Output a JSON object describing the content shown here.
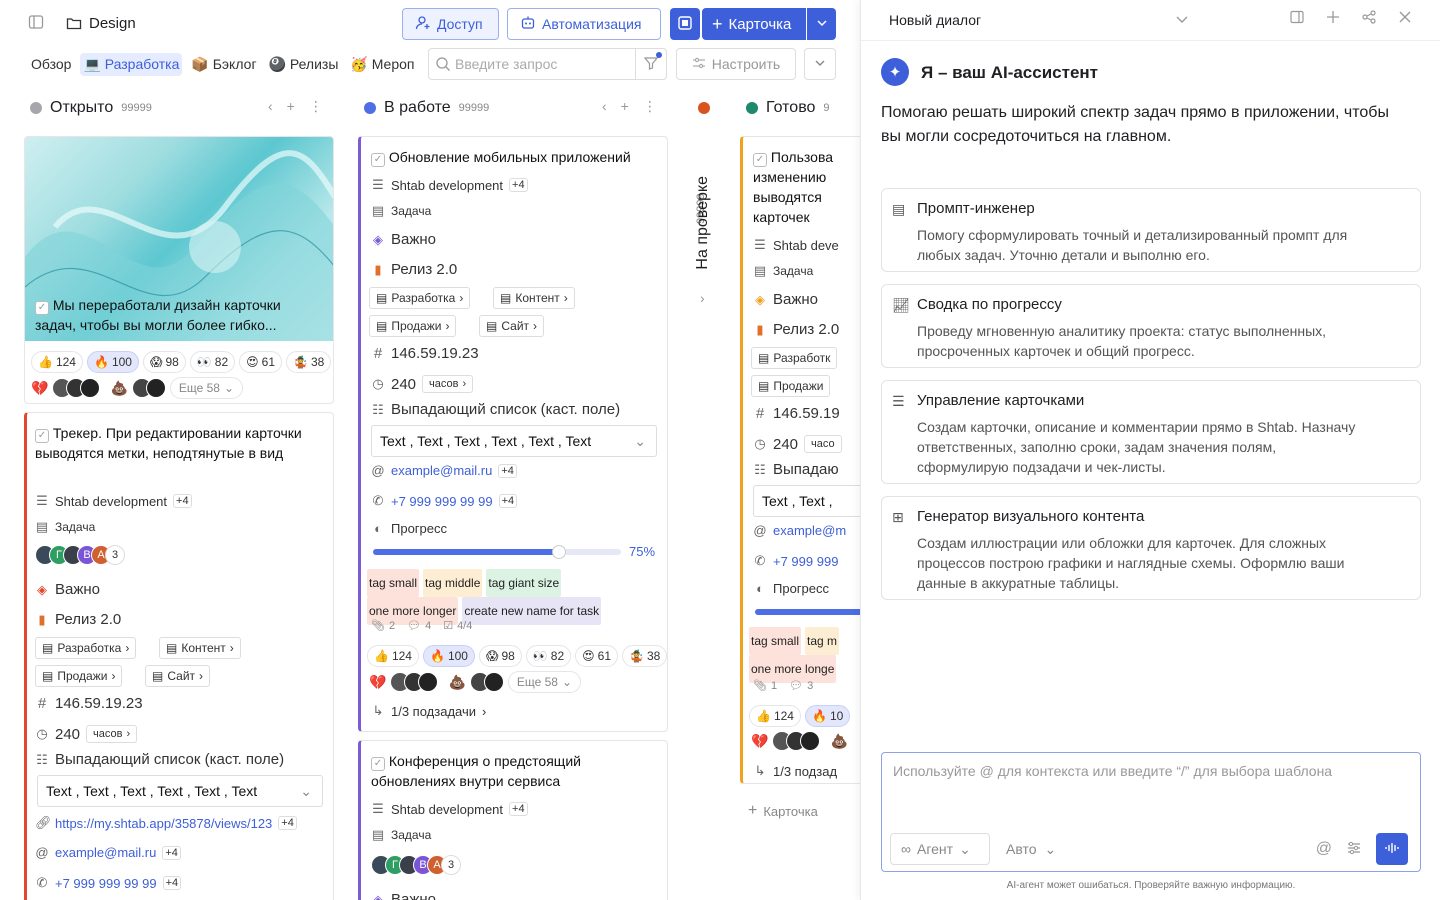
{
  "topbar": {
    "title": "Design",
    "access": "Доступ",
    "automation": "Автоматизация",
    "card_btn": "Карточка"
  },
  "tabs": [
    {
      "label": "Обзор"
    },
    {
      "label": "Разработка"
    },
    {
      "label": "Бэклог"
    },
    {
      "label": "Релизы"
    },
    {
      "label": "Мероп"
    }
  ],
  "tab_icons": [
    "",
    "💻",
    "📦",
    "🎱",
    "🥳"
  ],
  "search": {
    "placeholder": "Введите запрос"
  },
  "setup_label": "Настроить",
  "columns": [
    {
      "name": "Открыто",
      "count": "99999",
      "color": "#a6a6ad"
    },
    {
      "name": "В работе",
      "count": "99999",
      "color": "#4e6ee6"
    },
    {
      "name": "На проверке",
      "count": "99999",
      "color": "#d9531e"
    },
    {
      "name": "Готово",
      "count": "9",
      "color": "#1f8a6b"
    }
  ],
  "col1": {
    "card1": {
      "title": "Мы переработали дизайн карточки задач, чтобы вы могли более гибко...",
      "reactions": [
        {
          "e": "👍",
          "n": "124"
        },
        {
          "e": "🔥",
          "n": "100"
        },
        {
          "e": "😱",
          "n": "98"
        },
        {
          "e": "👀",
          "n": "82"
        },
        {
          "e": "😍",
          "n": "61"
        },
        {
          "e": "🤹",
          "n": "38"
        }
      ],
      "more": "Еще 58"
    },
    "card2": {
      "title": "Трекер. При редактировании карточки выводятся метки, неподтянутые в вид",
      "project": "Shtab development",
      "plus4": "+4",
      "type": "Задача",
      "avatars_count": "3",
      "priority": "Важно",
      "release": "Релиз 2.0",
      "chips": [
        "Разработка",
        "Контент",
        "Продажи",
        "Сайт"
      ],
      "ip": "146.59.19.23",
      "hours": "240",
      "hours_unit": "часов",
      "dropdown_label": "Выпадающий список (каст. поле)",
      "dropdown_value": "Text , Text , Text , Text , Text , Text",
      "url": "https://my.shtab.app/35878/views/123",
      "email": "example@mail.ru",
      "phone": "+7 999 999 99 99"
    }
  },
  "col2": {
    "card1": {
      "title": "Обновление мобильных приложений",
      "project": "Shtab development",
      "plus4": "+4",
      "type": "Задача",
      "priority": "Важно",
      "release": "Релиз 2.0",
      "chips": [
        "Разработка",
        "Контент",
        "Продажи",
        "Сайт"
      ],
      "ip": "146.59.19.23",
      "hours": "240",
      "hours_unit": "часов",
      "dropdown_label": "Выпадающий список (каст. поле)",
      "dropdown_value": "Text , Text , Text , Text , Text , Text",
      "email": "example@mail.ru",
      "phone": "+7 999 999 99 99",
      "progress_label": "Прогресс",
      "progress": 0.75,
      "progress_text": "75%",
      "tags": [
        {
          "t": "tag small",
          "c": "#fde2dc"
        },
        {
          "t": "tag middle",
          "c": "#fdeed3"
        },
        {
          "t": "tag giant size",
          "c": "#dcf2e3"
        },
        {
          "t": "one more longer",
          "c": "#fde2dc"
        },
        {
          "t": "create new name for task",
          "c": "#e6e4f5"
        }
      ],
      "attach": "2",
      "comments": "4",
      "checks": "4/4",
      "reactions": [
        {
          "e": "👍",
          "n": "124"
        },
        {
          "e": "🔥",
          "n": "100"
        },
        {
          "e": "😱",
          "n": "98"
        },
        {
          "e": "👀",
          "n": "82"
        },
        {
          "e": "😍",
          "n": "61"
        },
        {
          "e": "🤹",
          "n": "38"
        }
      ],
      "more": "Еще 58",
      "subtasks": "1/3 подзадачи"
    },
    "card2": {
      "title": "Конференция о предстоящий обновлениях внутри сервиса",
      "project": "Shtab development",
      "plus4": "+4",
      "type": "Задача",
      "avatars_count": "3",
      "priority": "Важно"
    }
  },
  "col4": {
    "card1": {
      "title": "Пользова изменению выводятся карточек",
      "project": "Shtab deve",
      "type": "Задача",
      "priority": "Важно",
      "release": "Релиз 2.0",
      "chips": [
        "Разработк",
        "Продажи"
      ],
      "ip": "146.59.19",
      "hours": "240",
      "hours_unit": "часо",
      "dropdown_label": "Выпадаю",
      "dropdown_value": "Text , Text ,",
      "email": "example@m",
      "phone": "+7 999 999",
      "progress_label": "Прогресс",
      "progress": 1,
      "tags": [
        {
          "t": "tag small",
          "c": "#fde2dc"
        },
        {
          "t": "tag m",
          "c": "#fdeed3"
        },
        {
          "t": "one more longe",
          "c": "#fde2dc"
        }
      ],
      "attach": "1",
      "comments": "3",
      "r1": "124",
      "r2": "10",
      "subtasks": "1/3 подзад"
    },
    "add_card": "Карточка"
  },
  "chat": {
    "title": "Новый диалог",
    "ai_title": "Я – ваш AI-ассистент",
    "ai_sub": "Помогаю решать широкий спектр задач прямо в приложении, чтобы вы могли сосредоточиться на главном.",
    "features": [
      {
        "title": "Промпт-инженер",
        "desc": "Помогу сформулировать точный и детализированный промпт для любых задач. Уточню детали и выполню его."
      },
      {
        "title": "Сводка по прогрессу",
        "desc": "Проведу мгновенную аналитику проекта: статус выполненных, просроченных карточек и общий прогресс."
      },
      {
        "title": "Управление карточками",
        "desc": "Создам карточки, описание и комментарии прямо в Shtab. Назначу ответственных, заполню сроки, задам значения полям, сформулирую подзадачи и чек-листы."
      },
      {
        "title": "Генератор визуального контента",
        "desc": "Создам иллюстрации или обложки для карточек. Для сложных процессов построю графики и наглядные схемы. Оформлю ваши данные в аккуратные таблицы."
      }
    ],
    "input_placeholder": "Используйте @ для контекста или введите “/” для выбора шаблона",
    "agent": "Агент",
    "auto": "Авто",
    "disclaimer": "AI-агент может ошибаться. Проверяйте важную информацию."
  }
}
